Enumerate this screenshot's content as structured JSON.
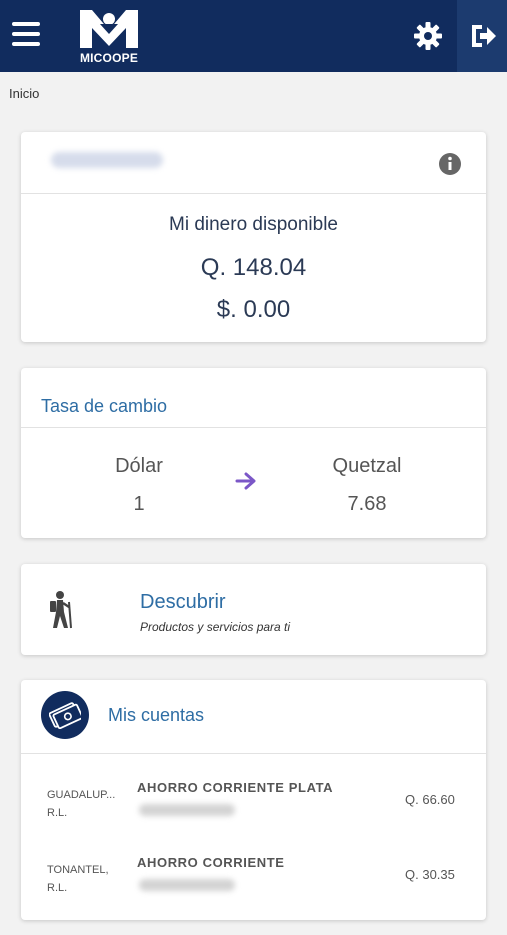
{
  "app": {
    "logo_text": "MICOOPE"
  },
  "icons": {
    "menu": "menu-icon",
    "settings": "gear-icon",
    "logout": "logout-icon",
    "info": "info-icon",
    "arrow": "arrow-right-icon",
    "discover": "hiker-icon",
    "accounts": "money-icon"
  },
  "colors": {
    "header": "#112c5e",
    "accent_title": "#2e6da4",
    "arrow": "#7b57c7"
  },
  "breadcrumb": "Inicio",
  "balance_card": {
    "label": "Mi dinero disponible",
    "amount_q": "Q. 148.04",
    "amount_usd": "$. 0.00"
  },
  "exchange_card": {
    "title": "Tasa de cambio",
    "from_currency": "Dólar",
    "from_value": "1",
    "to_currency": "Quetzal",
    "to_value": "7.68"
  },
  "discover_card": {
    "title": "Descubrir",
    "subtitle": "Productos y servicios para ti"
  },
  "accounts_card": {
    "title": "Mis cuentas",
    "accounts": [
      {
        "bank_line1": "GUADALUP...",
        "bank_line2": "R.L.",
        "type": "AHORRO CORRIENTE PLATA",
        "balance": "Q. 66.60"
      },
      {
        "bank_line1": "TONANTEL,",
        "bank_line2": "R.L.",
        "type": "AHORRO CORRIENTE",
        "balance": "Q. 30.35"
      }
    ]
  }
}
